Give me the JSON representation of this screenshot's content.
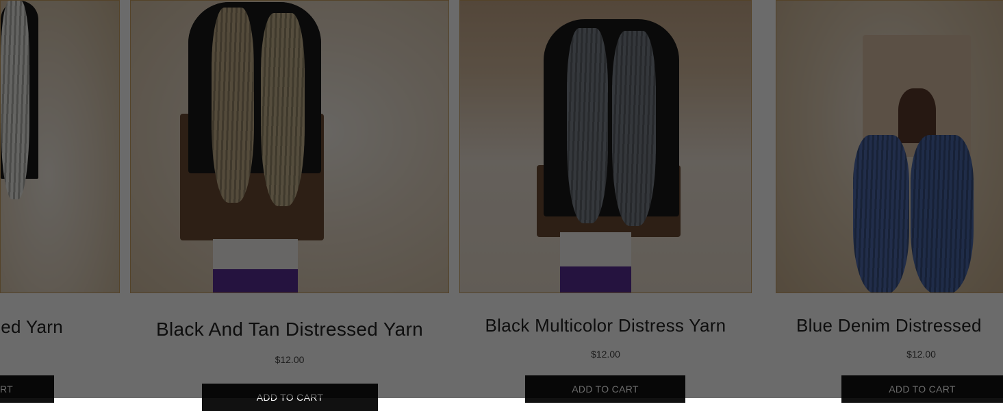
{
  "products": [
    {
      "title": "sed Yarn",
      "price": "",
      "cart_label": "RT"
    },
    {
      "title": "Black And Tan Distressed Yarn",
      "price": "$12.00",
      "cart_label": "ADD TO CART"
    },
    {
      "title": "Black Multicolor Distress Yarn",
      "price": "$12.00",
      "cart_label": "ADD TO CART"
    },
    {
      "title": "Blue Denim Distressed",
      "price": "$12.00",
      "cart_label": "ADD TO CART"
    }
  ],
  "colors": {
    "accent_border": "#c9a063",
    "button_bg": "#111111",
    "overlay": "rgba(0,0,0,0.58)"
  }
}
